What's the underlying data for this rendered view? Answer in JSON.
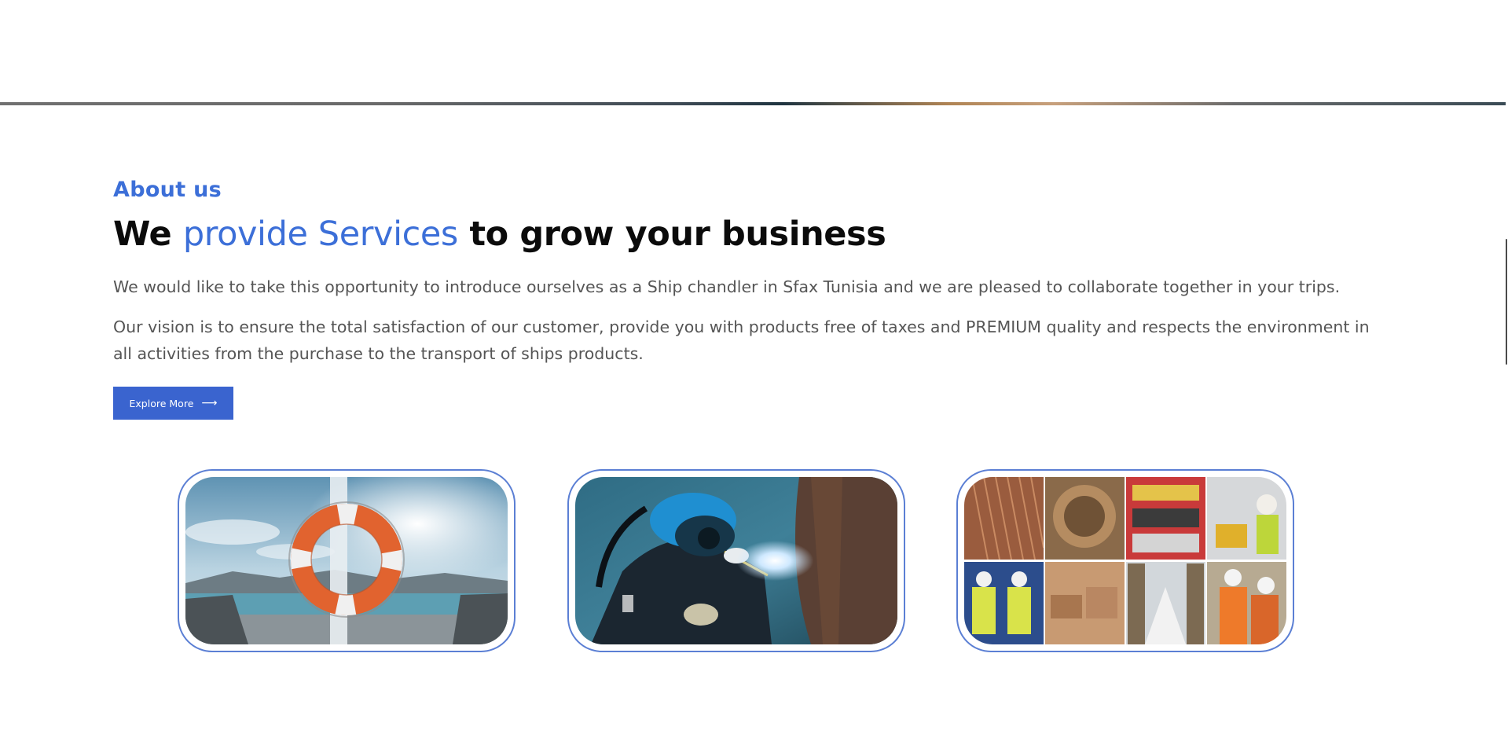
{
  "about": {
    "eyebrow": "About us",
    "headline_part1": "We ",
    "headline_accent": "provide Services",
    "headline_part2": " to grow your business",
    "paragraph_1": "We would like to take this opportunity to introduce ourselves as a Ship chandler in Sfax Tunisia and we are pleased to collaborate together in your trips.",
    "paragraph_2": "Our vision is to ensure the total satisfaction of our customer, provide you with products free of taxes and PREMIUM quality and respects the environment in all activities from the purchase to the transport of ships products."
  },
  "cta": {
    "label": "Explore More",
    "icon": "arrow-right-icon"
  },
  "service_images": [
    {
      "subject": "life-buoy-on-ship-deck"
    },
    {
      "subject": "underwater-welding-diver"
    },
    {
      "subject": "ship-supplies-warehouse-collage"
    }
  ],
  "colors": {
    "accent": "#3c6fd8",
    "button": "#3a64cf",
    "card_border": "#5b7fd4",
    "body_text": "#555555",
    "heading_text": "#0b0b0b"
  }
}
